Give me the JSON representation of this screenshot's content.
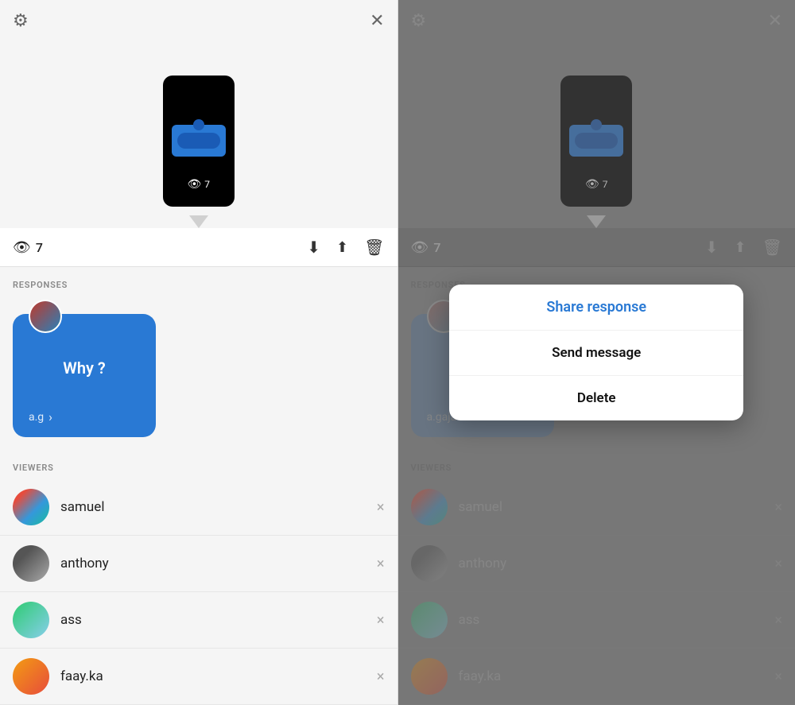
{
  "left_panel": {
    "settings_icon": "⚙",
    "close_icon": "✕",
    "view_count": "7",
    "eye_symbol": "👁",
    "responses_label": "RESPONSES",
    "viewers_label": "VIEWERS",
    "toolbar": {
      "download_icon": "⬇",
      "share_icon": "⬆",
      "delete_icon": "🗑"
    },
    "response_card": {
      "question": "Why ?",
      "username": "a.g",
      "arrow": "›"
    },
    "viewers": [
      {
        "name": "samuel",
        "avatar_class": "viewer-avatar-samuel"
      },
      {
        "name": "anthony",
        "avatar_class": "viewer-avatar-anthony"
      },
      {
        "name": "ass",
        "avatar_class": "viewer-avatar-ass"
      },
      {
        "name": "faay.ka",
        "avatar_class": "viewer-avatar-faay"
      }
    ],
    "phone_view_count": "7"
  },
  "right_panel": {
    "settings_icon": "⚙",
    "close_icon": "✕",
    "view_count": "7",
    "eye_symbol": "👁",
    "responses_label": "RESPONSES",
    "viewers_label": "VIEWERS",
    "toolbar": {
      "download_icon": "⬇",
      "share_icon": "⬆",
      "delete_icon": "🗑"
    },
    "viewers": [
      {
        "name": "samuel",
        "avatar_class": "viewer-avatar-samuel"
      },
      {
        "name": "anthony",
        "avatar_class": "viewer-avatar-anthony"
      },
      {
        "name": "ass",
        "avatar_class": "viewer-avatar-ass"
      },
      {
        "name": "faay.ka",
        "avatar_class": "viewer-avatar-faay"
      }
    ],
    "phone_view_count": "7"
  },
  "modal": {
    "share_response": "Share response",
    "send_message": "Send message",
    "delete": "Delete"
  }
}
